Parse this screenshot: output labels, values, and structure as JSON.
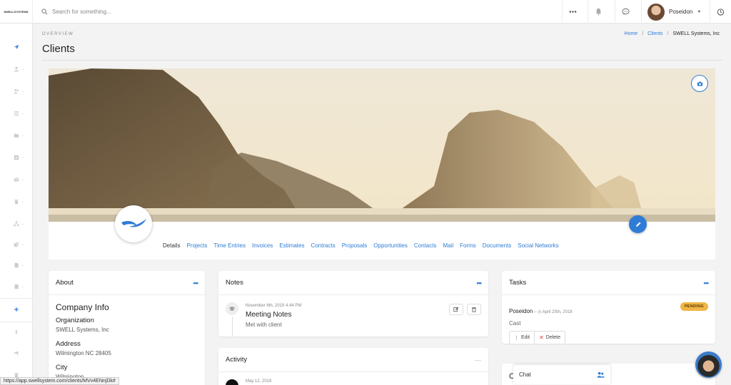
{
  "topbar": {
    "logo_text": "SWELLSYSTEMS",
    "search_placeholder": "Search for something...",
    "user_name": "Poseidon"
  },
  "icons": {
    "more": "more-icon",
    "notifications": "bell-icon",
    "messages": "chat-icon",
    "timer": "timer-icon"
  },
  "header": {
    "overview": "OVERVIEW",
    "title": "Clients",
    "breadcrumb": {
      "home": "Home",
      "clients": "Clients",
      "sep": "/",
      "current": "SWELL Systems, Inc"
    }
  },
  "tabs": [
    "Details",
    "Projects",
    "Time Entries",
    "Invoices",
    "Estimates",
    "Contracts",
    "Proposals",
    "Opportunities",
    "Contacts",
    "Mail",
    "Forms",
    "Documents",
    "Social Networks"
  ],
  "about": {
    "title": "About",
    "company_info": "Company Info",
    "org_label": "Organization",
    "org_value": "SWELL Systems, Inc",
    "address_label": "Address",
    "address_value": "Wilmington NC 28405",
    "city_label": "City",
    "city_value": "Wilmington"
  },
  "notes": {
    "title": "Notes",
    "date": "November 6th, 2019 4:44 PM",
    "note_title": "Meeting Notes",
    "note_desc": "Met with client"
  },
  "activity": {
    "title": "Activity",
    "date": "May 12, 2019",
    "collapse": "—"
  },
  "tasks": {
    "title": "Tasks",
    "who": "Poseidon",
    "sep": " – ",
    "date": "April 25th, 2018",
    "task_name": "Cast",
    "status": "PENDING",
    "edit": "Edit",
    "delete": "Delete"
  },
  "c_card": {
    "title": "C"
  },
  "chat": {
    "label": "Chat"
  },
  "statusbar": {
    "url": "https://app.swellsystem.com/clients/MVv4ENnjDk#"
  },
  "colors": {
    "accent": "#2f7cd6",
    "pending": "#f0b545"
  }
}
